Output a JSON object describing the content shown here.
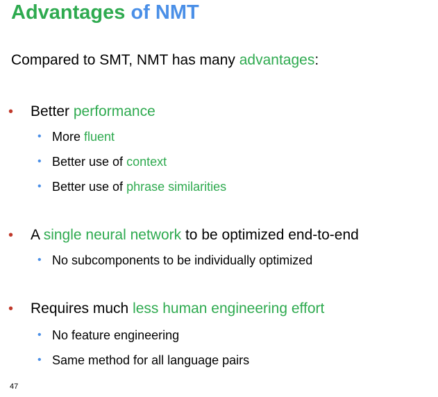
{
  "title": {
    "part1": "Advantages",
    "part2": "of NMT"
  },
  "intro": {
    "before": "Compared to SMT, NMT has many ",
    "highlight": "advantages",
    "after": ":"
  },
  "bullets": [
    {
      "before": "Better ",
      "highlight": "performance",
      "after": "",
      "sub": [
        {
          "before": "More ",
          "highlight": "fluent",
          "after": ""
        },
        {
          "before": "Better use of ",
          "highlight": "context",
          "after": ""
        },
        {
          "before": "Better use of ",
          "highlight": "phrase similarities",
          "after": ""
        }
      ]
    },
    {
      "before": "A ",
      "highlight": "single neural network",
      "after": " to be optimized end-to-end",
      "sub": [
        {
          "before": "No subcomponents to be individually optimized",
          "highlight": "",
          "after": ""
        }
      ]
    },
    {
      "before": "Requires much ",
      "highlight": "less human engineering effort",
      "after": "",
      "sub": [
        {
          "before": "No feature engineering",
          "highlight": "",
          "after": ""
        },
        {
          "before": "Same method for all language pairs",
          "highlight": "",
          "after": ""
        }
      ]
    }
  ],
  "bullet_glyph": "•",
  "page_number": "47",
  "colors": {
    "title_green": "#2eaa4f",
    "title_blue": "#4a8fe7",
    "highlight": "#2eaa4f",
    "level1_bullet": "#c0392b",
    "level2_bullet": "#4a8fe7"
  }
}
